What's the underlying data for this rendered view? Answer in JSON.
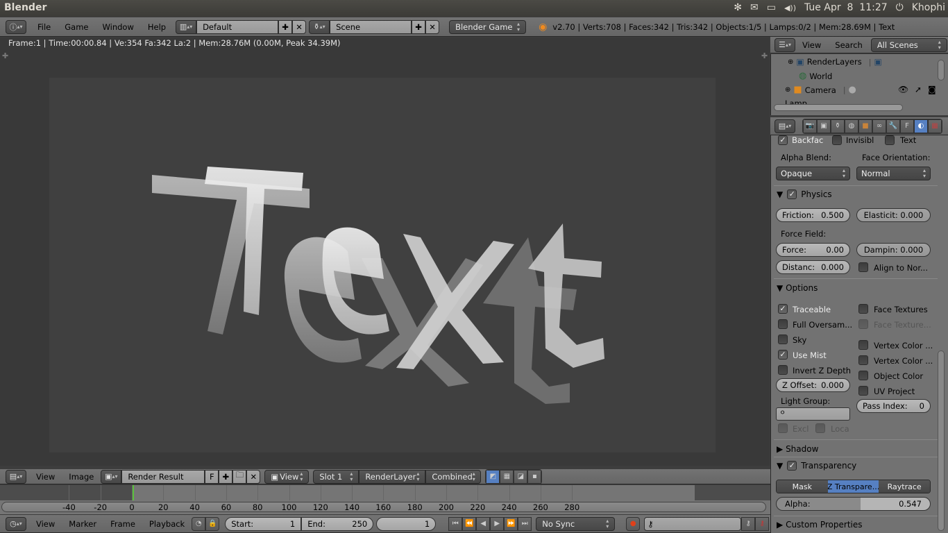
{
  "os_bar": {
    "app_title": "Blender",
    "tray": {
      "bluetooth_icon": "✻",
      "mail_icon": "✉",
      "battery_icon": "▭",
      "volume_icon": "◀))",
      "datetime": "Tue Apr  8  11:27",
      "power_icon": "⏻",
      "user": "Khophi"
    }
  },
  "info_header": {
    "menu": [
      "File",
      "Game",
      "Window",
      "Help"
    ],
    "screen_layout": "Default",
    "scene": "Scene",
    "engine": "Blender Game",
    "stats": "v2.70 | Verts:708 | Faces:342 | Tris:342 | Objects:1/5 | Lamps:0/2 | Mem:28.69M | Text"
  },
  "viewport": {
    "render_info": "Frame:1 | Time:00:00.84 | Ve:354 Fa:342 La:2 | Mem:28.76M (0.00M, Peak 34.39M)",
    "rendered_text": "Text"
  },
  "outliner": {
    "menu": [
      "View",
      "Search"
    ],
    "filter": "All Scenes",
    "items": [
      {
        "label": "RenderLayers"
      },
      {
        "label": "World"
      },
      {
        "label": "Camera"
      },
      {
        "label": "Lamp"
      }
    ]
  },
  "properties": {
    "tabs": [
      "render",
      "render-layers",
      "scene",
      "world",
      "object",
      "constraints",
      "modifiers",
      "data-font",
      "material",
      "texture"
    ],
    "active_tab": "material",
    "game_settings": {
      "backface": {
        "label": "Backfac",
        "checked": true
      },
      "invisible": {
        "label": "Invisibl",
        "checked": false
      },
      "text": {
        "label": "Text",
        "checked": false
      },
      "alpha_blend_label": "Alpha Blend:",
      "alpha_blend_value": "Opaque",
      "face_orientation_label": "Face Orientation:",
      "face_orientation_value": "Normal"
    },
    "physics": {
      "title": "Physics",
      "enabled": true,
      "friction": {
        "label": "Friction:",
        "value": "0.500"
      },
      "elasticity": {
        "label": "Elasticit:",
        "value": "0.000"
      },
      "force_field_label": "Force Field:",
      "force": {
        "label": "Force:",
        "value": "0.00"
      },
      "damping": {
        "label": "Dampin:",
        "value": "0.000"
      },
      "distance": {
        "label": "Distanc:",
        "value": "0.000"
      },
      "align_to_normal": {
        "label": "Align to Nor...",
        "checked": false
      }
    },
    "options": {
      "title": "Options",
      "left": [
        {
          "label": "Traceable",
          "checked": true
        },
        {
          "label": "Full Oversam...",
          "checked": false
        },
        {
          "label": "Sky",
          "checked": false
        },
        {
          "label": "Use Mist",
          "checked": true
        },
        {
          "label": "Invert Z Depth",
          "checked": false
        }
      ],
      "right": [
        {
          "label": "Face Textures",
          "checked": false
        },
        {
          "label": "Face Texture...",
          "checked": false,
          "disabled": true
        },
        {
          "label": "Vertex Color ...",
          "checked": false
        },
        {
          "label": "Vertex Color ...",
          "checked": false
        },
        {
          "label": "Object Color",
          "checked": false
        },
        {
          "label": "UV Project",
          "checked": false
        }
      ],
      "z_offset": {
        "label": "Z Offset:",
        "value": "0.000"
      },
      "light_group_label": "Light Group:",
      "light_group_value": "",
      "pass_index": {
        "label": "Pass Index:",
        "value": "0"
      },
      "excl": {
        "label": "Excl",
        "checked": false
      },
      "loca": {
        "label": "Loca",
        "checked": false
      }
    },
    "shadow": {
      "title": "Shadow"
    },
    "transparency": {
      "title": "Transparency",
      "enabled": true,
      "modes": [
        "Mask",
        "Z Transpare...",
        "Raytrace"
      ],
      "active_mode": 1,
      "alpha": {
        "label": "Alpha:",
        "value": "0.547",
        "fraction": 0.547
      }
    },
    "custom_properties": {
      "title": "Custom Properties"
    }
  },
  "image_editor_header": {
    "menu": [
      "View",
      "Image"
    ],
    "image": "Render Result",
    "fake_user": "F",
    "view": "View",
    "slot": "Slot 1",
    "layer": "RenderLayer",
    "pass": "Combined"
  },
  "timeline": {
    "ticks": [
      "-40",
      "-20",
      "0",
      "20",
      "40",
      "60",
      "80",
      "100",
      "120",
      "140",
      "160",
      "180",
      "200",
      "220",
      "240",
      "260",
      "280"
    ],
    "current_frame_marker": 1
  },
  "timeline_header": {
    "menu": [
      "View",
      "Marker",
      "Frame",
      "Playback"
    ],
    "start": {
      "label": "Start:",
      "value": "1"
    },
    "end": {
      "label": "End:",
      "value": "250"
    },
    "current_frame": "1",
    "sync": "No Sync",
    "record_color": "#e0401a"
  }
}
